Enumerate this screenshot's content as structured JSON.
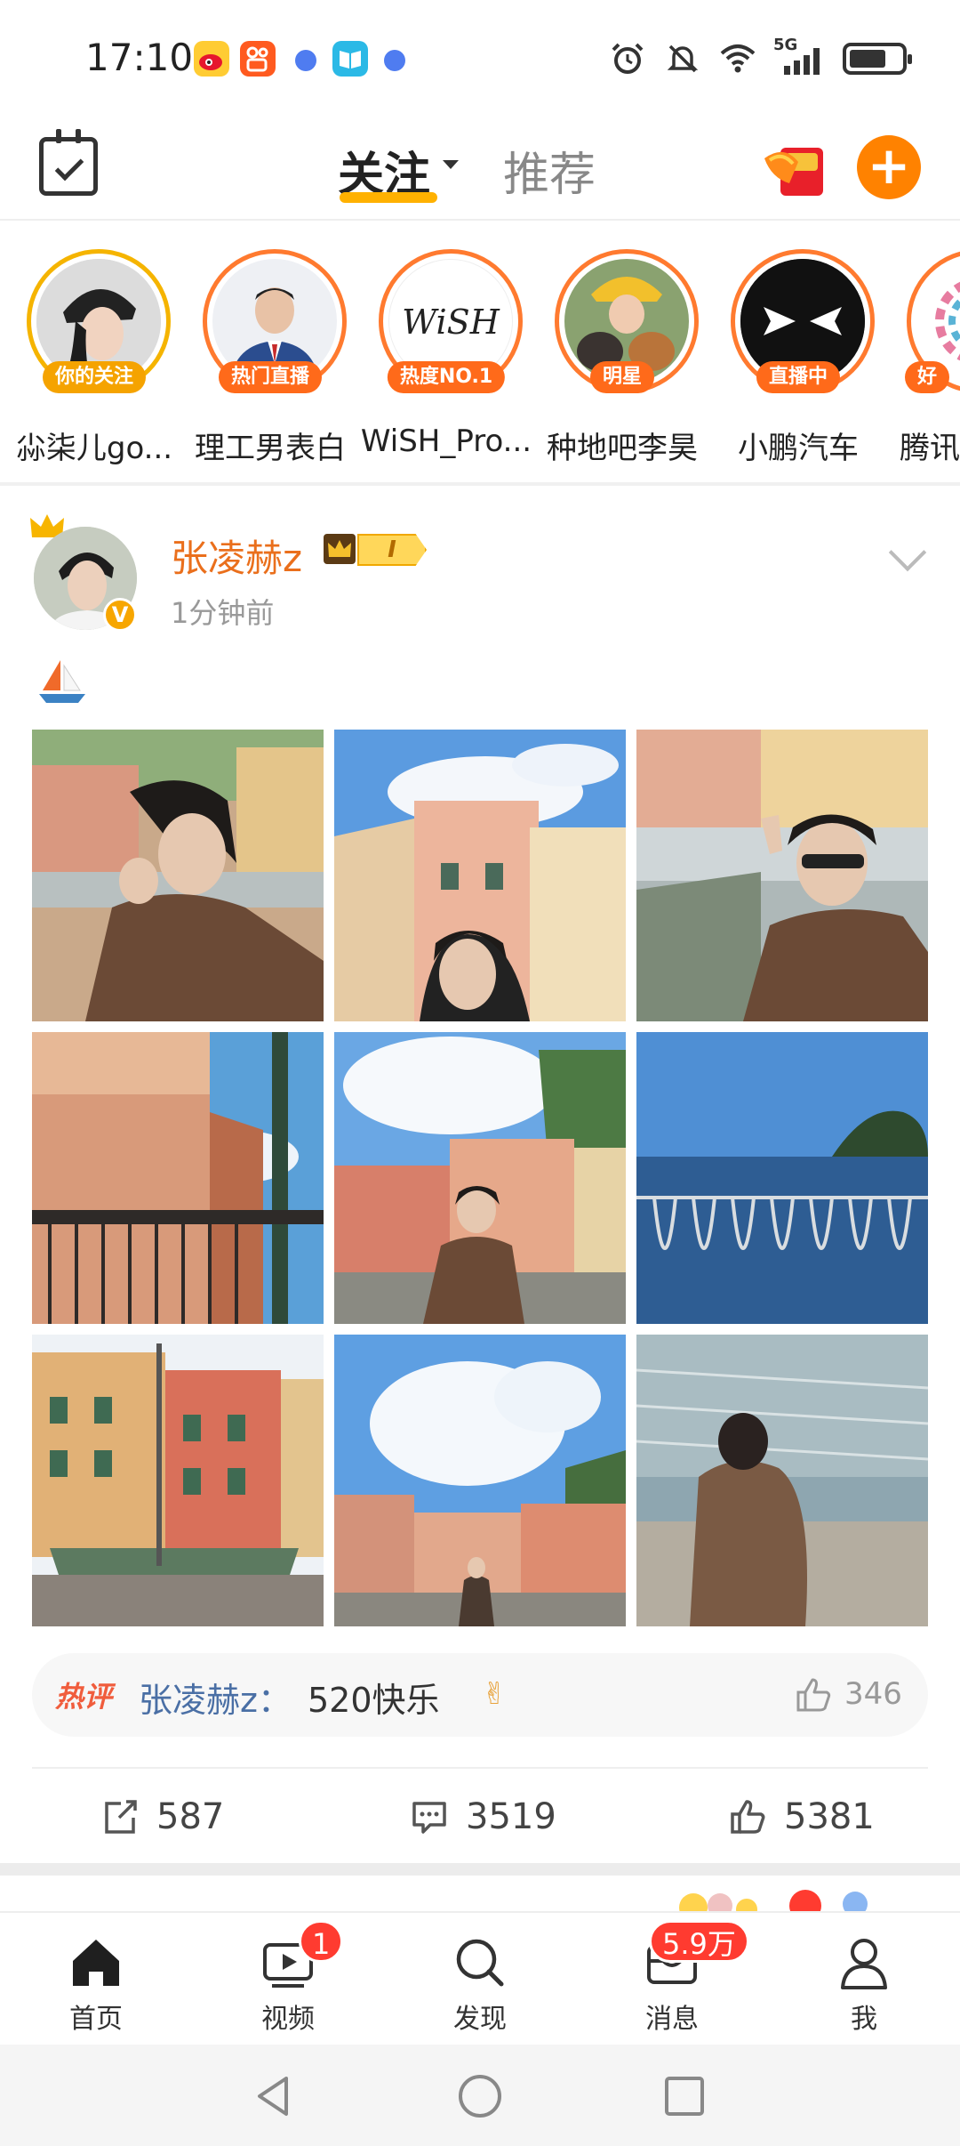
{
  "status_bar": {
    "time": "17:10",
    "network": "5G",
    "icons": [
      "weibo-app-icon",
      "kuaishou-app-icon",
      "dot-icon",
      "reader-app-icon",
      "dot-icon",
      "alarm-icon",
      "mute-icon",
      "wifi-icon",
      "signal-icon",
      "battery-icon"
    ]
  },
  "top_nav": {
    "tabs": [
      {
        "label": "关注",
        "active": true
      },
      {
        "label": "推荐",
        "active": false
      }
    ],
    "accent_color": "#ff8200"
  },
  "stories": [
    {
      "name": "尛柒儿go...",
      "badge": "你的关注"
    },
    {
      "name": "理工男表白",
      "badge": "热门直播"
    },
    {
      "name": "WiSH_Pro...",
      "badge": "热度NO.1",
      "avatar_text": "WiSH"
    },
    {
      "name": "种地吧李昊",
      "badge": "明星"
    },
    {
      "name": "小鹏汽车",
      "badge": "直播中"
    },
    {
      "name": "腾讯",
      "badge": "好"
    }
  ],
  "post": {
    "author": "张凌赫z",
    "vip_level": "I",
    "time": "1分钟前",
    "text_emoji": "sailboat-emoji",
    "hot_comment": {
      "tag": "热评",
      "author": "张凌赫z：",
      "text": "520快乐",
      "emoji": "✌",
      "likes": "346"
    },
    "actions": {
      "reposts": "587",
      "comments": "3519",
      "likes": "5381"
    }
  },
  "bottom_nav": [
    {
      "label": "首页",
      "icon": "home-icon"
    },
    {
      "label": "视频",
      "icon": "video-icon",
      "badge": "1"
    },
    {
      "label": "发现",
      "icon": "search-icon"
    },
    {
      "label": "消息",
      "icon": "message-icon",
      "badge": "5.9万"
    },
    {
      "label": "我",
      "icon": "profile-icon"
    }
  ]
}
